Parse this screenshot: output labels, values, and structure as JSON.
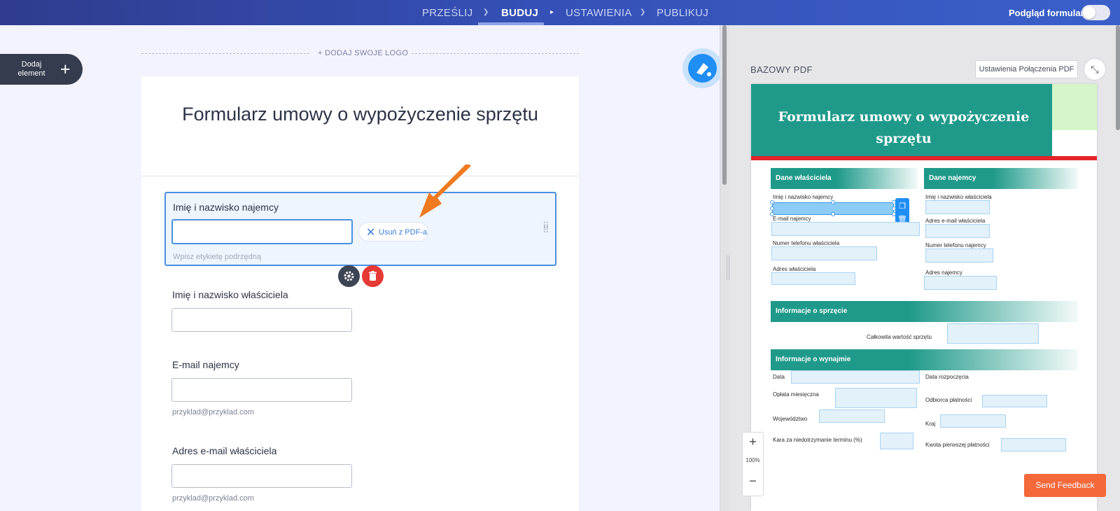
{
  "topnav": {
    "steps": [
      {
        "label": "PRZEŚLIJ"
      },
      {
        "label": "BUDUJ"
      },
      {
        "label": "USTAWIENIA"
      },
      {
        "label": "PUBLIKUJ"
      }
    ],
    "active_step": "BUDUJ",
    "preview_label": "Podgląd formularza",
    "preview_toggle_on": false
  },
  "builder": {
    "add_element_label": "Dodaj element",
    "add_logo": "+ DODAJ SWOJE LOGO",
    "form_title": "Formularz umowy o wypożyczenie sprzętu",
    "selected_field": {
      "label": "Imię i nazwisko najemcy",
      "input_value": "",
      "remove_pdf_label": "Usuń z PDF-a",
      "sublabel_placeholder": "Wpisz etykietę podrzędną"
    },
    "fields": [
      {
        "label": "Imię i nazwisko właściciela",
        "sublabel": ""
      },
      {
        "label": "E-mail najemcy",
        "sublabel": "przyklad@przyklad.com"
      },
      {
        "label": "Adres e-mail właściciela",
        "sublabel": "przyklad@przyklad.com"
      }
    ]
  },
  "pdf_panel": {
    "base_pdf_label": "BAZOWY PDF",
    "pdf_connection_settings": "Ustawienia Połączenia PDF",
    "zoom": "100%",
    "colors": {
      "header": "#1f9a8a",
      "accent_red": "#e3242b",
      "field_fill": "#e3f1fb"
    },
    "document": {
      "title": "Formularz umowy o wypożyczenie sprzętu",
      "sections": {
        "owner": "Dane właściciela",
        "tenant": "Dane najemcy",
        "equipment": "Informacje o sprzęcie",
        "rental": "Informacje o wynajmie"
      },
      "labels": {
        "tenant_name": "Imię i nazwisko najemcy",
        "tenant_email": "E-mail najemcy",
        "owner_phone": "Numer telefonu właściciela",
        "owner_address": "Adres właściciela",
        "owner_name": "Imię i nazwisko właściciela",
        "owner_email": "Adres e-mail właściciela",
        "tenant_phone": "Numer telefonu najemcy",
        "tenant_address": "Adres najemcy",
        "total_value": "Całkowita wartość sprzętu",
        "date": "Data",
        "start_date": "Data rozpoczęcia",
        "monthly_fee": "Opłata miesięczna",
        "payee": "Odbiorca płatności",
        "province": "Województwo",
        "country": "Kraj",
        "late_penalty": "Kara za niedotrzymanie terminu (%)",
        "first_payment": "Kwota pierwszej płatności"
      }
    }
  },
  "send_feedback": "Send Feedback"
}
